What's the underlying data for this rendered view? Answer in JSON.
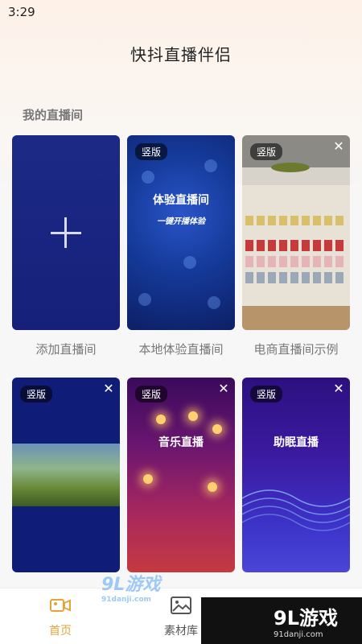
{
  "status_bar": {
    "time": "3:29"
  },
  "header": {
    "title": "快抖直播伴侣"
  },
  "section": {
    "title": "我的直播间"
  },
  "cards": [
    {
      "caption": "添加直播间"
    },
    {
      "badge": "竖版",
      "title": "体验直播间",
      "subtitle": "一键开播体验",
      "caption": "本地体验直播间"
    },
    {
      "badge": "竖版",
      "caption": "电商直播间示例"
    },
    {
      "badge": "竖版"
    },
    {
      "badge": "竖版",
      "title": "音乐直播"
    },
    {
      "badge": "竖版",
      "title": "助眠直播"
    }
  ],
  "bottom_nav": {
    "items": [
      {
        "label": "首页",
        "icon": "video-camera-icon",
        "active": true
      },
      {
        "label": "素材库",
        "icon": "image-icon",
        "active": false
      }
    ]
  },
  "watermarks": {
    "logo": "9L游戏",
    "site": "91danji.com",
    "logo_right": "9L游戏",
    "site_right": "91danji.com"
  },
  "colors": {
    "accent": "#e6a33a",
    "text_muted": "#777777"
  }
}
